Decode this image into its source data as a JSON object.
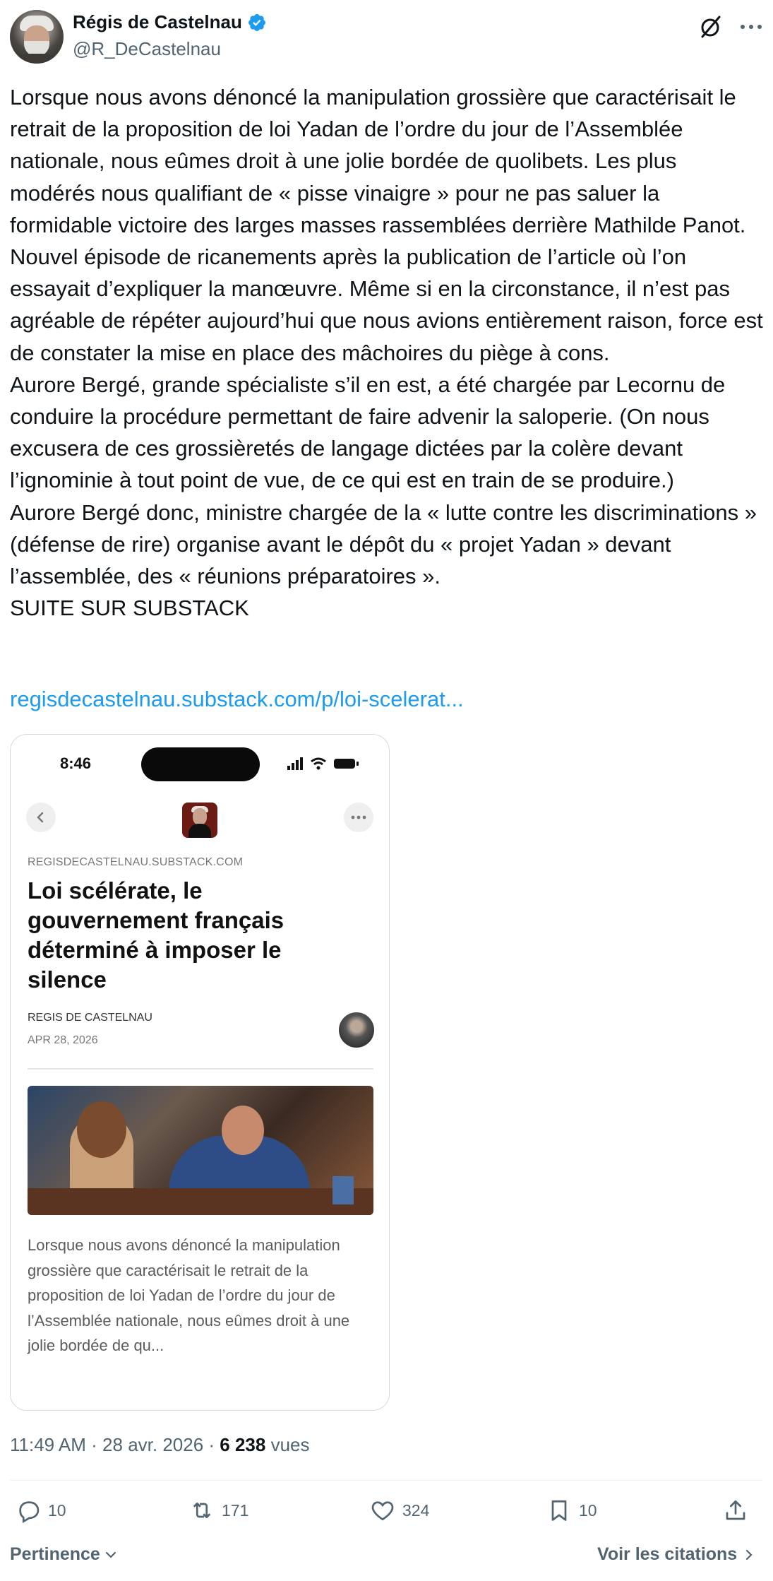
{
  "author": {
    "display_name": "Régis de Castelnau",
    "handle": "@R_DeCastelnau",
    "verified": true
  },
  "icons": {
    "verified": "verified-badge-icon",
    "grok": "grok-icon",
    "more": "more-icon"
  },
  "tweet": {
    "text": "Lorsque nous avons dénoncé la manipulation grossière que caractérisait le retrait de la proposition de loi Yadan de l’ordre du jour de l’Assemblée nationale, nous eûmes droit à une jolie bordée de quolibets. Les plus modérés nous qualifiant de « pisse vinaigre » pour ne pas saluer la formidable victoire des larges masses rassemblées derrière Mathilde Panot.\nNouvel épisode de ricanements après la publication de l’article où l’on essayait d’expliquer la manœuvre. Même si en la circonstance, il n’est pas agréable de répéter aujourd’hui que nous avions entièrement raison, force est de constater la mise en place des mâchoires du piège à cons.\nAurore Bergé, grande spécialiste s’il en est, a été chargée par Lecornu de conduire la procédure permettant de faire advenir la saloperie. (On nous excusera de ces grossièretés de langage dictées par la colère devant l’ignominie à tout point de vue, de ce qui est en train de se produire.)\nAurore Bergé donc, ministre chargée de la « lutte contre les discriminations » (défense de rire) organise avant le dépôt du « projet Yadan » devant l’assemblée, des « réunions préparatoires ».\nSUITE SUR SUBSTACK",
    "link": "regisdecastelnau.substack.com/p/loi-scelerat..."
  },
  "card": {
    "status_time": "8:46",
    "domain": "REGISDECASTELNAU.SUBSTACK.COM",
    "title": "Loi scélérate, le gouvernement français déterminé à imposer le silence",
    "author": "REGIS DE CASTELNAU",
    "date": "APR 28, 2026",
    "excerpt": "Lorsque nous avons dénoncé la manipulation grossière que caractérisait le retrait de la proposition de loi Yadan de l’ordre du jour de l’Assemblée nationale, nous eûmes droit à une jolie bordée de qu..."
  },
  "meta": {
    "time": "11:49 AM",
    "date": "28 avr. 2026",
    "views_count": "6 238",
    "views_label": "vues",
    "separator": " · "
  },
  "actions": {
    "replies": "10",
    "reposts": "171",
    "likes": "324",
    "bookmarks": "10"
  },
  "footer": {
    "sort_label": "Pertinence",
    "quotes_label": "Voir les citations"
  },
  "colors": {
    "text": "#0f1419",
    "secondary": "#536471",
    "link": "#1d9bf0",
    "verified": "#1d9bf0"
  }
}
